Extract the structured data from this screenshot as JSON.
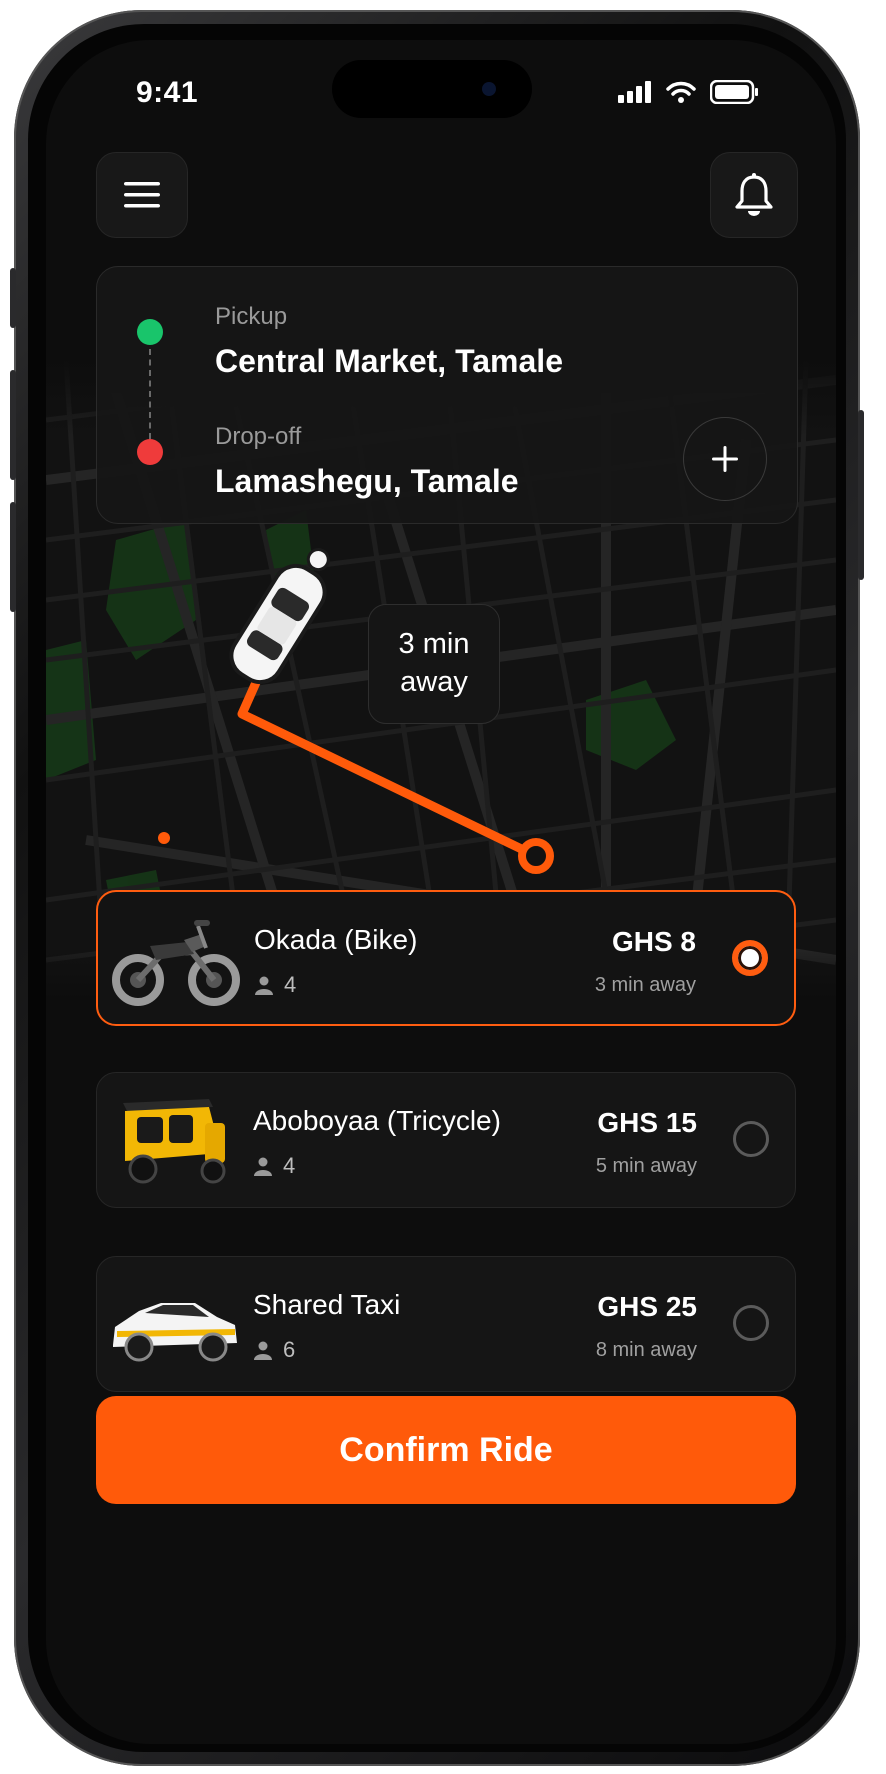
{
  "status_bar": {
    "time": "9:41"
  },
  "header": {
    "menu_icon": "hamburger-menu-icon",
    "notification_icon": "bell-icon"
  },
  "route": {
    "pickup_label": "Pickup",
    "pickup_value": "Central Market, Tamale",
    "dropoff_label": "Drop-off",
    "dropoff_value": "Lamashegu, Tamale",
    "add_stop_icon": "plus-icon"
  },
  "map": {
    "eta_line1": "3 min",
    "eta_line2": "away"
  },
  "rides": [
    {
      "name": "Okada (Bike)",
      "seats": "4",
      "price": "GHS 8",
      "eta": "3 min away",
      "selected": true,
      "vehicle_icon": "motorbike-icon"
    },
    {
      "name": "Aboboyaa (Tricycle)",
      "seats": "4",
      "price": "GHS 15",
      "eta": "5 min away",
      "selected": false,
      "vehicle_icon": "tricycle-icon"
    },
    {
      "name": "Shared Taxi",
      "seats": "6",
      "price": "GHS 25",
      "eta": "8 min away",
      "selected": false,
      "vehicle_icon": "taxi-icon"
    }
  ],
  "confirm_button": "Confirm Ride",
  "colors": {
    "accent": "#ff5a0a",
    "pickup_dot": "#19c56b",
    "dropoff_dot": "#ef3b3b",
    "background": "#0d0d0d"
  }
}
